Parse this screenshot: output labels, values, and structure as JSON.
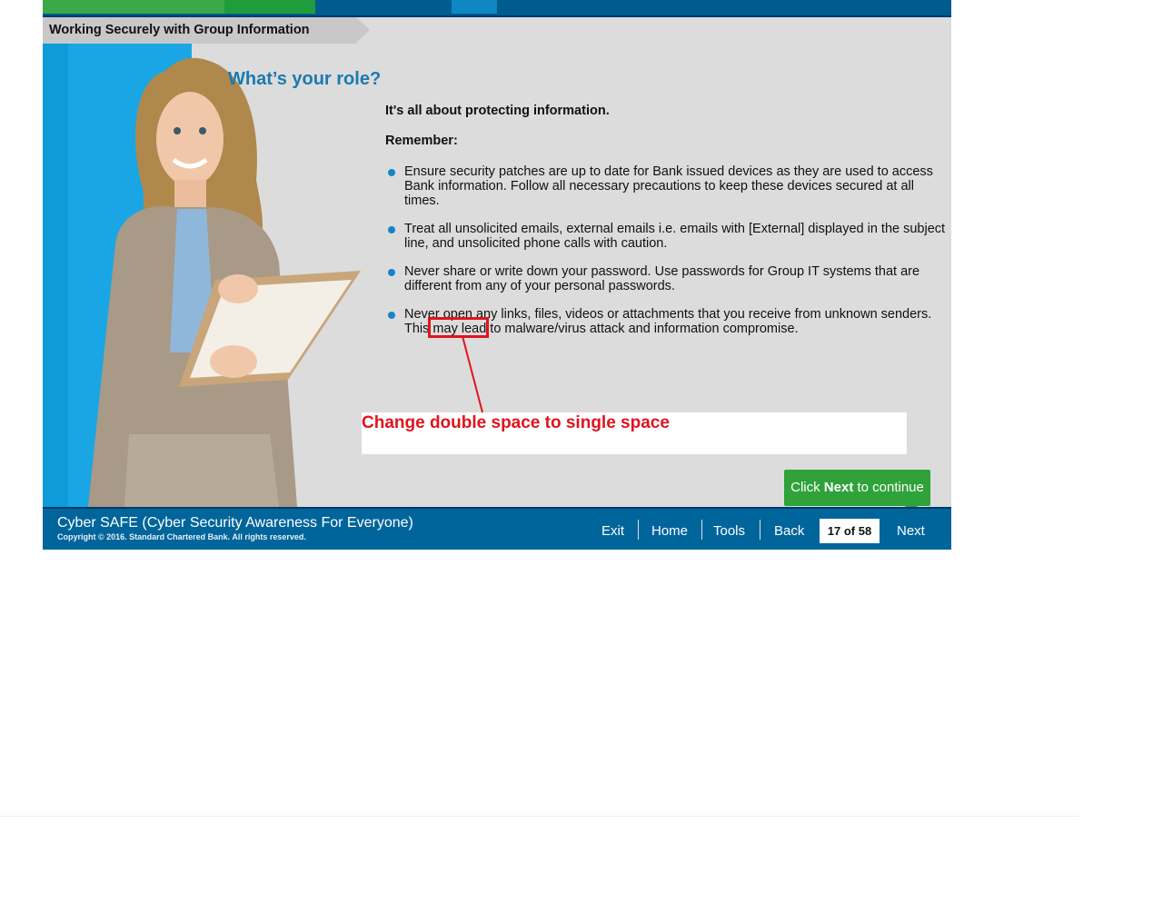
{
  "header": {
    "title": "Working Securely with Group Information",
    "strip_colors": [
      "#39a94a",
      "#1f9c3b",
      "#005b8f",
      "#0f87c5",
      "#005b8f"
    ]
  },
  "slide": {
    "heading": "What’s your role?",
    "intro": "It's all about protecting information.",
    "remember": "Remember:",
    "bullets": [
      "Ensure security patches are up to date for Bank issued devices as they are used to access Bank information. Follow all necessary precautions to keep these devices secured at all times.",
      "Treat all unsolicited emails, external emails i.e. emails with [External] displayed in the subject line, and unsolicited phone calls with caution.",
      "Never share or write down your password. Use passwords for Group IT systems that are different from any of your personal passwords.",
      "Never open any links, files, videos or attachments that you receive from unknown senders.  This may lead to malware/virus attack and information compromise."
    ]
  },
  "annotation": {
    "text": "Change double space to single space",
    "color": "#e0141f"
  },
  "next_hint": {
    "prefix": "Click ",
    "bold": "Next",
    "suffix": " to continue"
  },
  "footer": {
    "course_name": "Cyber SAFE (Cyber Security Awareness For Everyone)",
    "copyright": "Copyright © 2016. Standard Chartered Bank. All rights reserved.",
    "nav": {
      "exit": "Exit",
      "home": "Home",
      "tools": "Tools",
      "back": "Back",
      "page": "17 of 58",
      "next": "Next"
    }
  }
}
